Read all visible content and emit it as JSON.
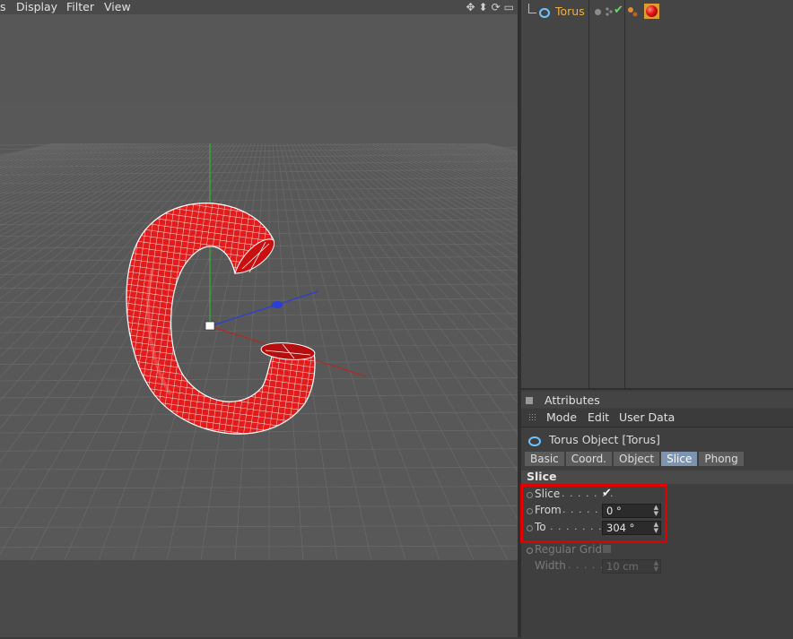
{
  "viewport": {
    "menu": [
      "s",
      "Display",
      "Filter",
      "View"
    ],
    "tools": [
      "move-view-icon",
      "zoom-view-icon",
      "rotate-view-icon",
      "maximize-view-icon"
    ]
  },
  "object_manager": {
    "object": {
      "name": "Torus",
      "icon": "torus-icon",
      "enabled_check": "✔",
      "material": "red-material-icon"
    }
  },
  "attributes": {
    "title": "Attributes",
    "menu": [
      "Mode",
      "Edit",
      "User Data"
    ],
    "object_label": "Torus Object [Torus]",
    "tabs": [
      "Basic",
      "Coord.",
      "Object",
      "Slice",
      "Phong"
    ],
    "active_tab": "Slice",
    "section": "Slice",
    "params": {
      "slice": {
        "label": "Slice",
        "dots": ". . . . . . .",
        "value": "✔"
      },
      "from": {
        "label": "From",
        "dots": ". . . . . . .",
        "value": "0 °"
      },
      "to": {
        "label": "To",
        "dots": ". . . . . . . . .",
        "value": "304 °"
      },
      "regular_grid": {
        "label": "Regular Grid"
      },
      "width": {
        "label": "Width",
        "dots": ". . . . . . .",
        "value": "10 cm"
      }
    }
  },
  "colors": {
    "accent": "#7d93b0",
    "object_name": "#f0b040",
    "highlight": "#e00000",
    "torus": "#e21b1b"
  }
}
